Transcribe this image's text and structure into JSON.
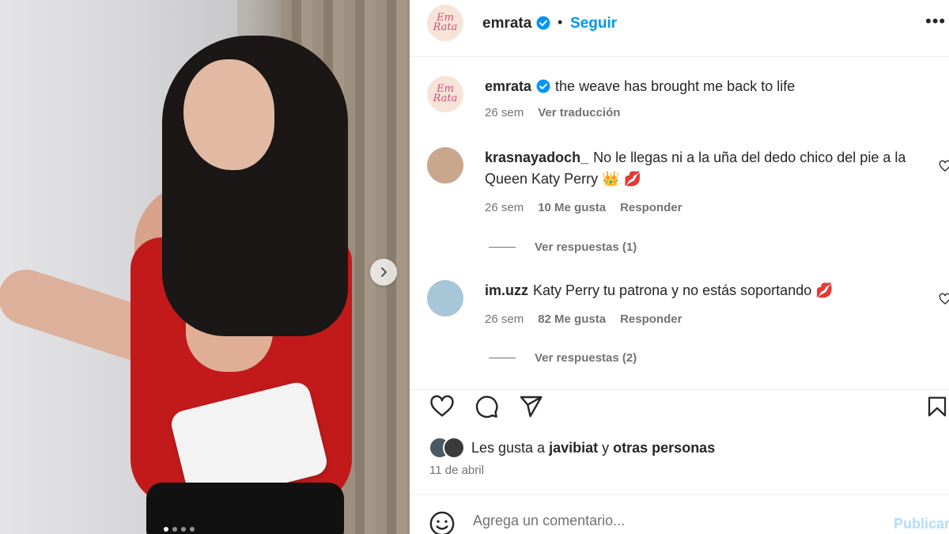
{
  "post": {
    "author": "emrata",
    "follow_label": "Seguir",
    "separator": "•",
    "more_label": "•••",
    "avatar_text": "Em Rata",
    "next_icon": "chevron-right-icon",
    "carousel_dots": 4
  },
  "caption": {
    "user": "emrata",
    "text": "the weave has brought me back to life",
    "time": "26 sem",
    "translate": "Ver traducción"
  },
  "comments": [
    {
      "user": "krasnayadoch_",
      "text": "No le llegas ni a la uña del dedo chico del pie a la Queen Katy Perry 👑 💋",
      "time": "26 sem",
      "likes": "10 Me gusta",
      "reply": "Responder",
      "view_replies": "Ver respuestas (1)"
    },
    {
      "user": "im.uzz",
      "text": "Katy Perry tu patrona y no estás soportando 💋",
      "time": "26 sem",
      "likes": "82 Me gusta",
      "reply": "Responder",
      "view_replies": "Ver respuestas (2)"
    }
  ],
  "likes": {
    "prefix": "Les gusta a",
    "user": "javibiat",
    "connector": "y",
    "others": "otras personas"
  },
  "date": "11 de abril",
  "composer": {
    "placeholder": "Agrega un comentario...",
    "publish": "Publicar"
  },
  "colors": {
    "accent": "#0095f6",
    "verified": "#0095f6",
    "muted": "#737373",
    "publish_disabled": "#b3dbff"
  }
}
